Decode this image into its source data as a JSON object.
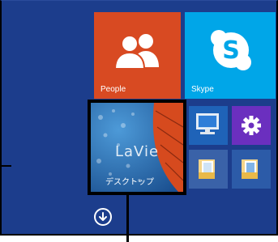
{
  "tiles": {
    "people": {
      "label": "People",
      "icon": "people-icon",
      "color": "#d84a22"
    },
    "skype": {
      "label": "Skype",
      "icon": "skype-icon",
      "color": "#00a6e8"
    },
    "desktop": {
      "label": "デスクトップ",
      "logo": "LaVie",
      "icon": "desktop-wallpaper"
    },
    "small": [
      {
        "icon": "computer-icon",
        "color": "#1f63b8"
      },
      {
        "icon": "gear-icon",
        "color": "#6b2fbf"
      },
      {
        "icon": "folder-icon",
        "color": "#3a62a8"
      },
      {
        "icon": "folder-icon",
        "color": "#2c5ba8"
      }
    ]
  },
  "controls": {
    "all_apps_icon": "down-arrow-circle-icon"
  }
}
